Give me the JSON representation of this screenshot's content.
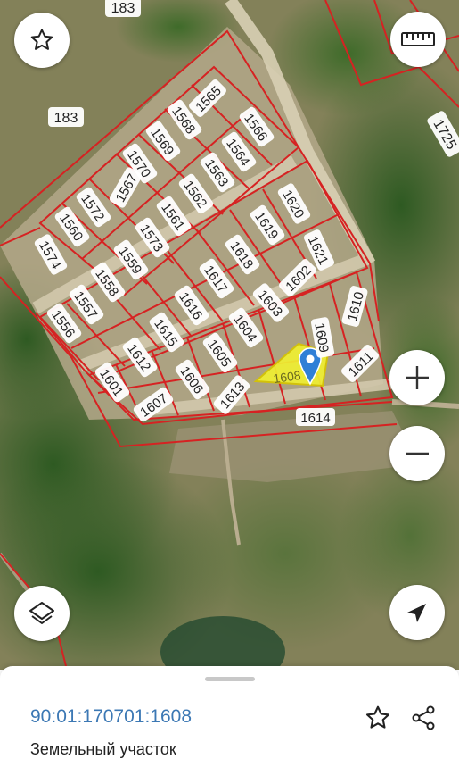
{
  "map": {
    "selected_plot": "1608",
    "outer_labels": [
      "183",
      "183",
      "1725"
    ],
    "plot_labels": [
      "1565",
      "1566",
      "1564",
      "1568",
      "1569",
      "1570",
      "1567",
      "1563",
      "1562",
      "1572",
      "1561",
      "1560",
      "1573",
      "1574",
      "1559",
      "1558",
      "1557",
      "1556",
      "1620",
      "1619",
      "1621",
      "1618",
      "1602",
      "1617",
      "1603",
      "1616",
      "1610",
      "1604",
      "1615",
      "1609",
      "1605",
      "1612",
      "1611",
      "1606",
      "1601",
      "1613",
      "1607",
      "1614"
    ],
    "colors": {
      "boundary": "#d62222",
      "selected_fill": "#f0f032",
      "marker": "#2f7fd6"
    }
  },
  "controls": {
    "favorite_icon": "star-outline-icon",
    "ruler_icon": "ruler-icon",
    "zoom_in_icon": "plus-icon",
    "zoom_out_icon": "minus-icon",
    "layers_icon": "layers-icon",
    "locate_icon": "navigation-arrow-icon"
  },
  "sheet": {
    "cadastral_number": "90:01:170701:1608",
    "plot_type": "Земельный участок",
    "favorite_icon": "star-outline-icon",
    "share_icon": "share-icon"
  }
}
